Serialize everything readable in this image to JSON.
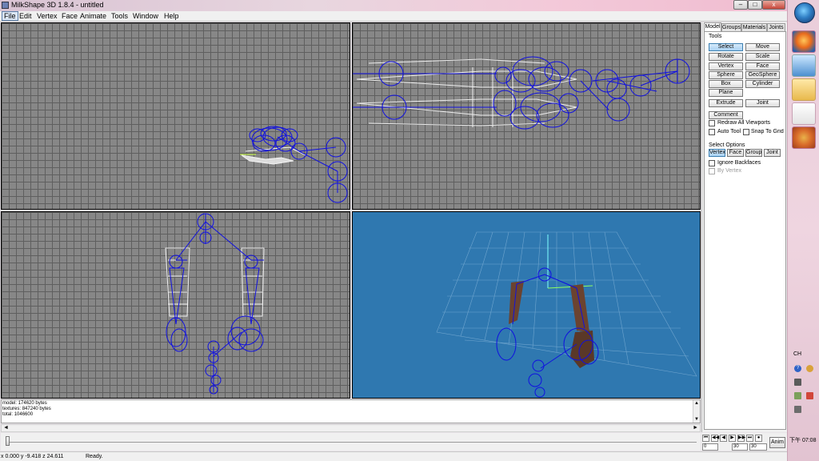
{
  "window": {
    "title": "MilkShape 3D 1.8.4 - untitled",
    "minimize_glyph": "–",
    "maximize_glyph": "□",
    "close_glyph": "x"
  },
  "menu": [
    "File",
    "Edit",
    "Vertex",
    "Face",
    "Animate",
    "Tools",
    "Window",
    "Help"
  ],
  "viewports": {
    "top_left": "front wireframe",
    "top_right": "side wireframe",
    "bottom_left": "top wireframe",
    "bottom_right": "3D perspective"
  },
  "panel": {
    "tabs": [
      "Model",
      "Groups",
      "Materials",
      "Joints"
    ],
    "active_tab": "Model",
    "tools_label": "Tools",
    "tools": [
      "Select",
      "Move",
      "Rotate",
      "Scale",
      "Vertex",
      "Face",
      "Sphere",
      "GeoSphere",
      "Box",
      "Cylinder",
      "Plane",
      "Extrude",
      "Joint"
    ],
    "active_tool": "Select",
    "comment_label": "Comment",
    "redraw_label": "Redraw All Viewports",
    "autotool_label": "Auto Tool",
    "snap_label": "Snap To Grid",
    "select_options_label": "Select Options",
    "select_modes": [
      "Vertex",
      "Face",
      "Group",
      "Joint"
    ],
    "active_select_mode": "Vertex",
    "ignore_backfaces_label": "Ignore Backfaces",
    "by_vertex_label": "By Vertex"
  },
  "log": {
    "lines": [
      {
        "name": "model:",
        "value": "174620 bytes"
      },
      {
        "name": "textures:",
        "value": "847240 bytes"
      },
      {
        "name": "total:",
        "value": "1046600"
      }
    ]
  },
  "playback": {
    "frame_start": "0",
    "frame_current": "30",
    "frame_end": "30",
    "anim_label": "Anim",
    "buttons": [
      "⏮",
      "◀◀",
      "◀",
      "▶",
      "▶▶",
      "⏭",
      "●"
    ]
  },
  "status": {
    "coords": "x 0.000 y -9.418 z 24.611",
    "state": "Ready."
  },
  "tray": {
    "lang": "CH",
    "clock": "下午 07:08",
    "help_glyph": "?"
  },
  "colors": {
    "wire": "#1010e0",
    "vertex": "#ffffff",
    "grid": "#5f5f5f",
    "viewport_bg": "#878787",
    "perspective_bg": "#2f78b0",
    "skin": "#6b4330"
  }
}
